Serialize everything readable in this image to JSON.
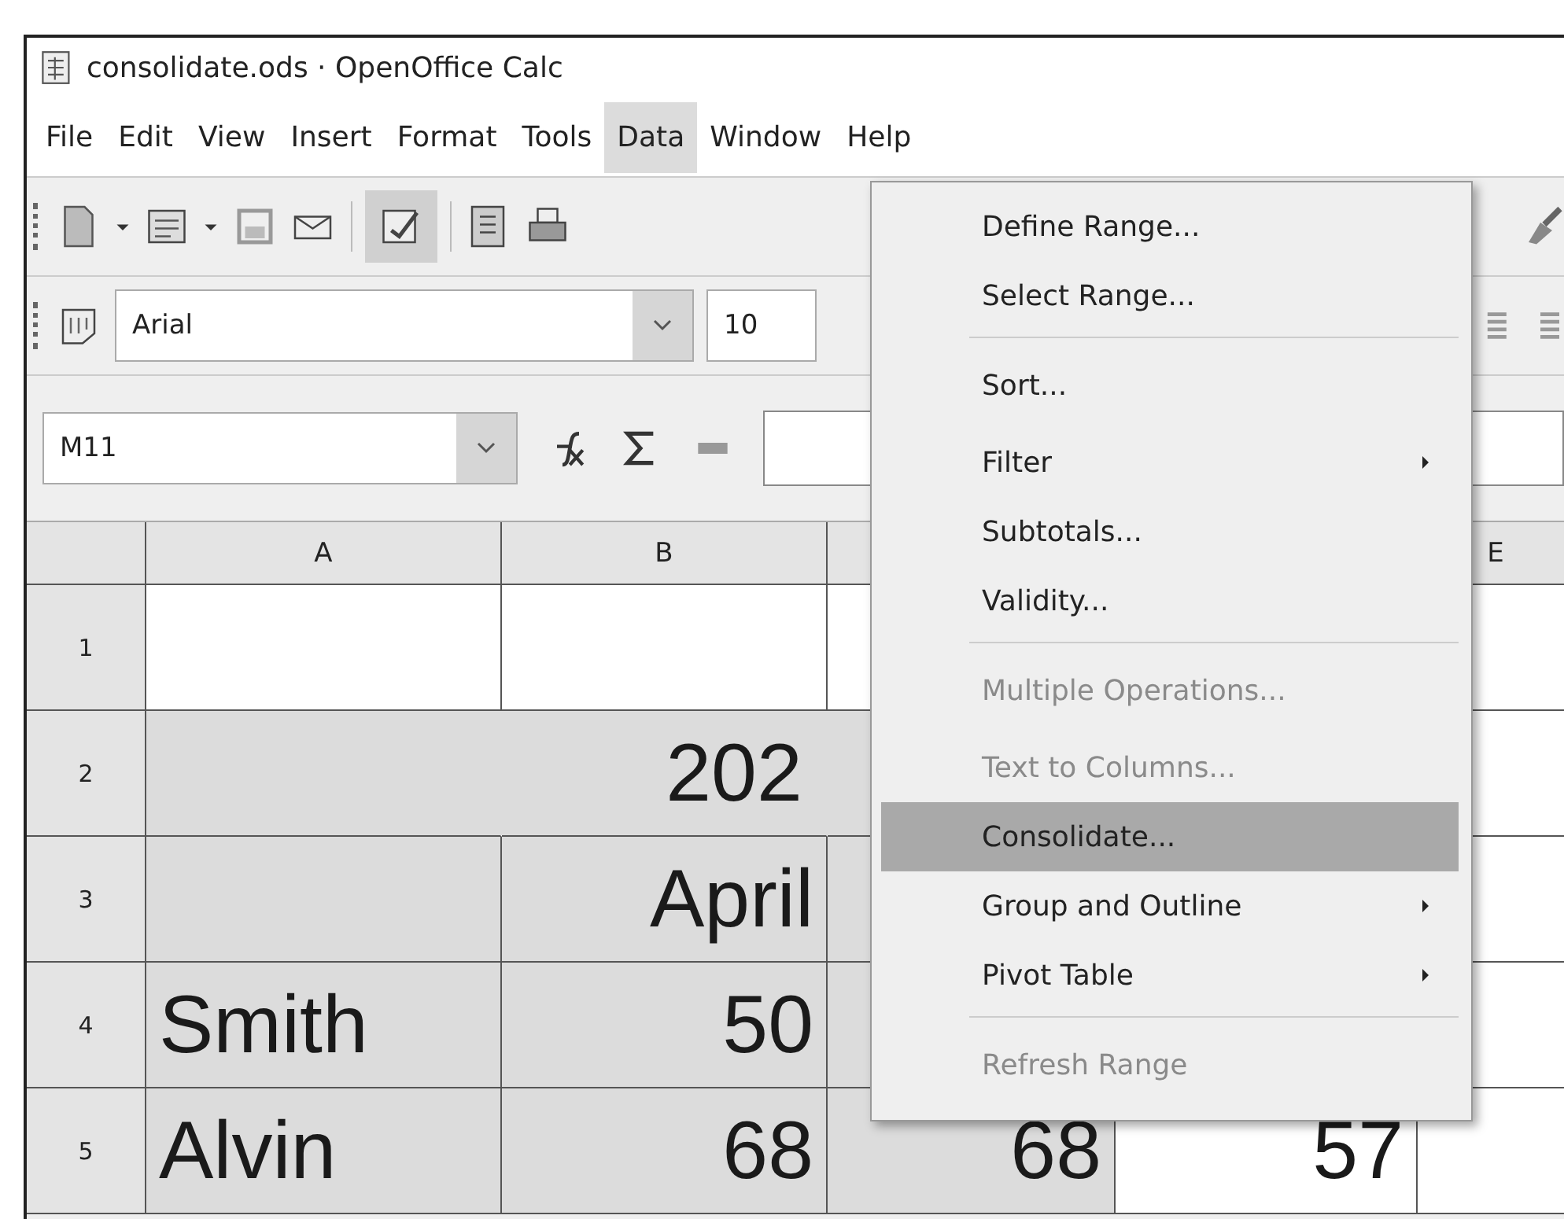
{
  "window": {
    "title": "consolidate.ods · OpenOffice Calc"
  },
  "menu_bar": [
    {
      "label": "File",
      "selected": false
    },
    {
      "label": "Edit",
      "selected": false
    },
    {
      "label": "View",
      "selected": false
    },
    {
      "label": "Insert",
      "selected": false
    },
    {
      "label": "Format",
      "selected": false
    },
    {
      "label": "Tools",
      "selected": false
    },
    {
      "label": "Data",
      "selected": true
    },
    {
      "label": "Window",
      "selected": false
    },
    {
      "label": "Help",
      "selected": false
    }
  ],
  "formatting": {
    "font_name": "Arial",
    "font_size": "10"
  },
  "formula_bar": {
    "name_box": "M11"
  },
  "sheet": {
    "columns": [
      "A",
      "B",
      null,
      null,
      "E"
    ],
    "rows": [
      {
        "number": "1",
        "cells": [
          {
            "shaded": false
          },
          {
            "shaded": false
          },
          {
            "shaded": false
          },
          {},
          {
            "shaded": false
          }
        ]
      },
      {
        "number": "2",
        "merged_text": "202",
        "cells": [
          {},
          {},
          {},
          {},
          {
            "shaded": false
          }
        ]
      },
      {
        "number": "3",
        "cells": [
          {
            "shaded": true
          },
          {
            "text": "April",
            "shaded": true
          },
          {
            "shaded": true
          },
          {},
          {
            "shaded": false
          }
        ]
      },
      {
        "number": "4",
        "cells": [
          {
            "text": "Smith",
            "shaded": true
          },
          {
            "text": "50",
            "shaded": true
          },
          {
            "shaded": true
          },
          {},
          {
            "shaded": false
          }
        ]
      },
      {
        "number": "5",
        "cells": [
          {
            "text": "Alvin",
            "shaded": true
          },
          {
            "text": "68",
            "shaded": true
          },
          {
            "text": "68",
            "shaded": true
          },
          {
            "text": "57",
            "shaded": false
          },
          {
            "shaded": false
          }
        ]
      }
    ]
  },
  "data_menu": [
    {
      "label": "Define Range...",
      "disabled": false,
      "selected": false,
      "submenu": false,
      "group_start": false
    },
    {
      "label": "Select Range...",
      "disabled": false,
      "selected": false,
      "submenu": false,
      "group_start": false
    },
    {
      "label": "Sort...",
      "disabled": false,
      "selected": false,
      "submenu": false,
      "group_start": true
    },
    {
      "label": "Filter",
      "disabled": false,
      "selected": false,
      "submenu": true,
      "group_start": false
    },
    {
      "label": "Subtotals...",
      "disabled": false,
      "selected": false,
      "submenu": false,
      "group_start": false
    },
    {
      "label": "Validity...",
      "disabled": false,
      "selected": false,
      "submenu": false,
      "group_start": false
    },
    {
      "label": "Multiple Operations...",
      "disabled": true,
      "selected": false,
      "submenu": false,
      "group_start": true
    },
    {
      "label": "Text to Columns...",
      "disabled": true,
      "selected": false,
      "submenu": false,
      "group_start": false
    },
    {
      "label": "Consolidate...",
      "disabled": false,
      "selected": true,
      "submenu": false,
      "group_start": false
    },
    {
      "label": "Group and Outline",
      "disabled": false,
      "selected": false,
      "submenu": true,
      "group_start": false
    },
    {
      "label": "Pivot Table",
      "disabled": false,
      "selected": false,
      "submenu": true,
      "group_start": false
    },
    {
      "label": "Refresh Range",
      "disabled": true,
      "selected": false,
      "submenu": false,
      "group_start": true
    }
  ]
}
